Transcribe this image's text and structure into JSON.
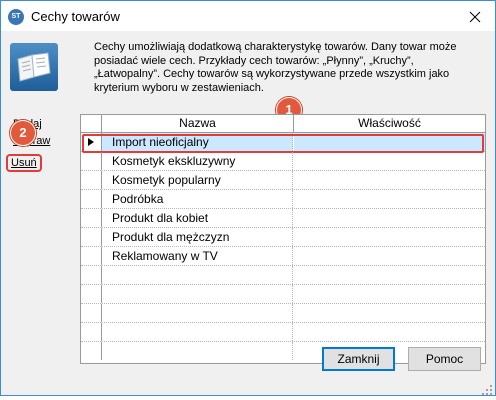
{
  "window": {
    "title": "Cechy towarów",
    "app_icon_text": "ST"
  },
  "description": "Cechy umożliwiają dodatkową charakterystykę towarów. Dany towar może\nposiadać wiele cech. Przykłady cech towarów: „Płynny”, „Kruchy”,\n„Łatwopalny”. Cechy towarów są wykorzystywane przede wszystkim jako\nkryterium wyboru w zestawieniach.",
  "actions": {
    "add": "Dodaj",
    "edit": "Popraw",
    "delete": "Usuń"
  },
  "badges": {
    "one": "1",
    "two": "2"
  },
  "grid": {
    "columns": {
      "name": "Nazwa",
      "property": "Właściwość"
    },
    "rows": [
      {
        "name": "Import nieoficjalny",
        "property": ""
      },
      {
        "name": "Kosmetyk ekskluzywny",
        "property": ""
      },
      {
        "name": "Kosmetyk popularny",
        "property": ""
      },
      {
        "name": "Podróbka",
        "property": ""
      },
      {
        "name": "Produkt dla kobiet",
        "property": ""
      },
      {
        "name": "Produkt dla mężczyzn",
        "property": ""
      },
      {
        "name": "Reklamowany w TV",
        "property": ""
      }
    ],
    "selected_row": "Import nieoficjalny"
  },
  "buttons": {
    "close": "Zamknij",
    "help": "Pomoc"
  },
  "colors": {
    "accent": "#0078d7",
    "highlight": "#e03c3c",
    "selection": "#cce8ff"
  }
}
